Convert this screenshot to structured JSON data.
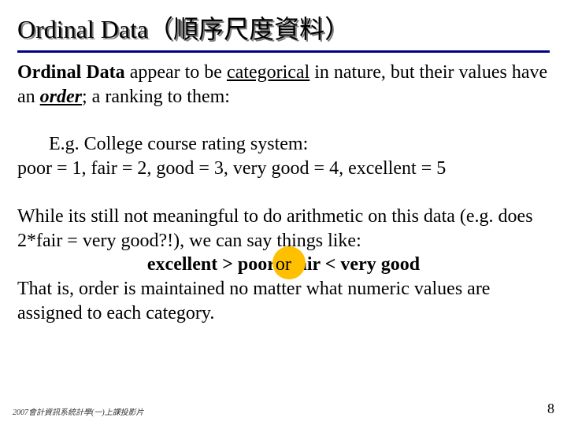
{
  "title": {
    "text_en": "Ordinal Data",
    "text_zh": "（順序尺度資料）"
  },
  "para1": {
    "lead": "Ordinal Data",
    "mid1": " appear to be ",
    "cat": "categorical",
    "mid2": " in nature, but their values have an ",
    "order": "order",
    "tail": "; a ranking to them:"
  },
  "para2": {
    "line1": "E.g. College course rating system:",
    "line2": "poor = 1, fair = 2, good = 3, very good = 4, excellent = 5"
  },
  "para3": {
    "line1": "While its still not meaningful to do arithmetic on this data (e.g. does 2*fair = very good?!), we can say things like:",
    "cmp1": "excellent > poor",
    "or": " or ",
    "cmp2": "fair < very good",
    "line3": "That is, order is maintained no matter what numeric values are assigned to each category."
  },
  "footer": {
    "left": "2007會計資訊系統計學(一)上課投影片",
    "page": "8"
  }
}
